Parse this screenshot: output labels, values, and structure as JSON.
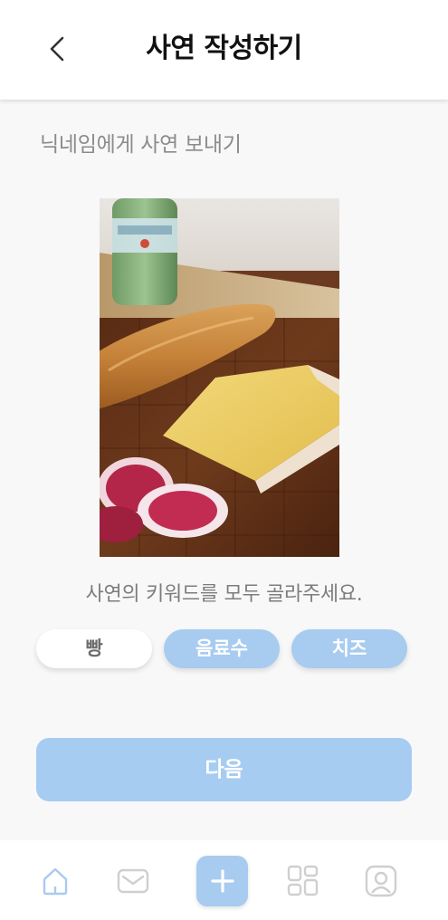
{
  "header": {
    "title": "사연 작성하기",
    "back_icon": "chevron-left-icon"
  },
  "subtitle": "닉네임에게 사연 보내기",
  "photo": {
    "subject": "baguette, cheese wedge, sparkling water bottle and watermelon radish slices on a wooden board"
  },
  "instruction": "사연의 키워드를 모두 골라주세요.",
  "keywords": [
    {
      "label": "빵",
      "selected": false
    },
    {
      "label": "음료수",
      "selected": true
    },
    {
      "label": "치즈",
      "selected": true
    }
  ],
  "next_button": {
    "label": "다음"
  },
  "bottom_nav": {
    "items": [
      "home-icon",
      "mail-icon",
      "plus-icon",
      "grid-icon",
      "profile-icon"
    ],
    "active": "home-icon"
  },
  "colors": {
    "accent": "#a8cbf0",
    "background": "#f8f8f9",
    "text_muted": "#8b8b8b",
    "nav_inactive": "#cfcfcf"
  }
}
